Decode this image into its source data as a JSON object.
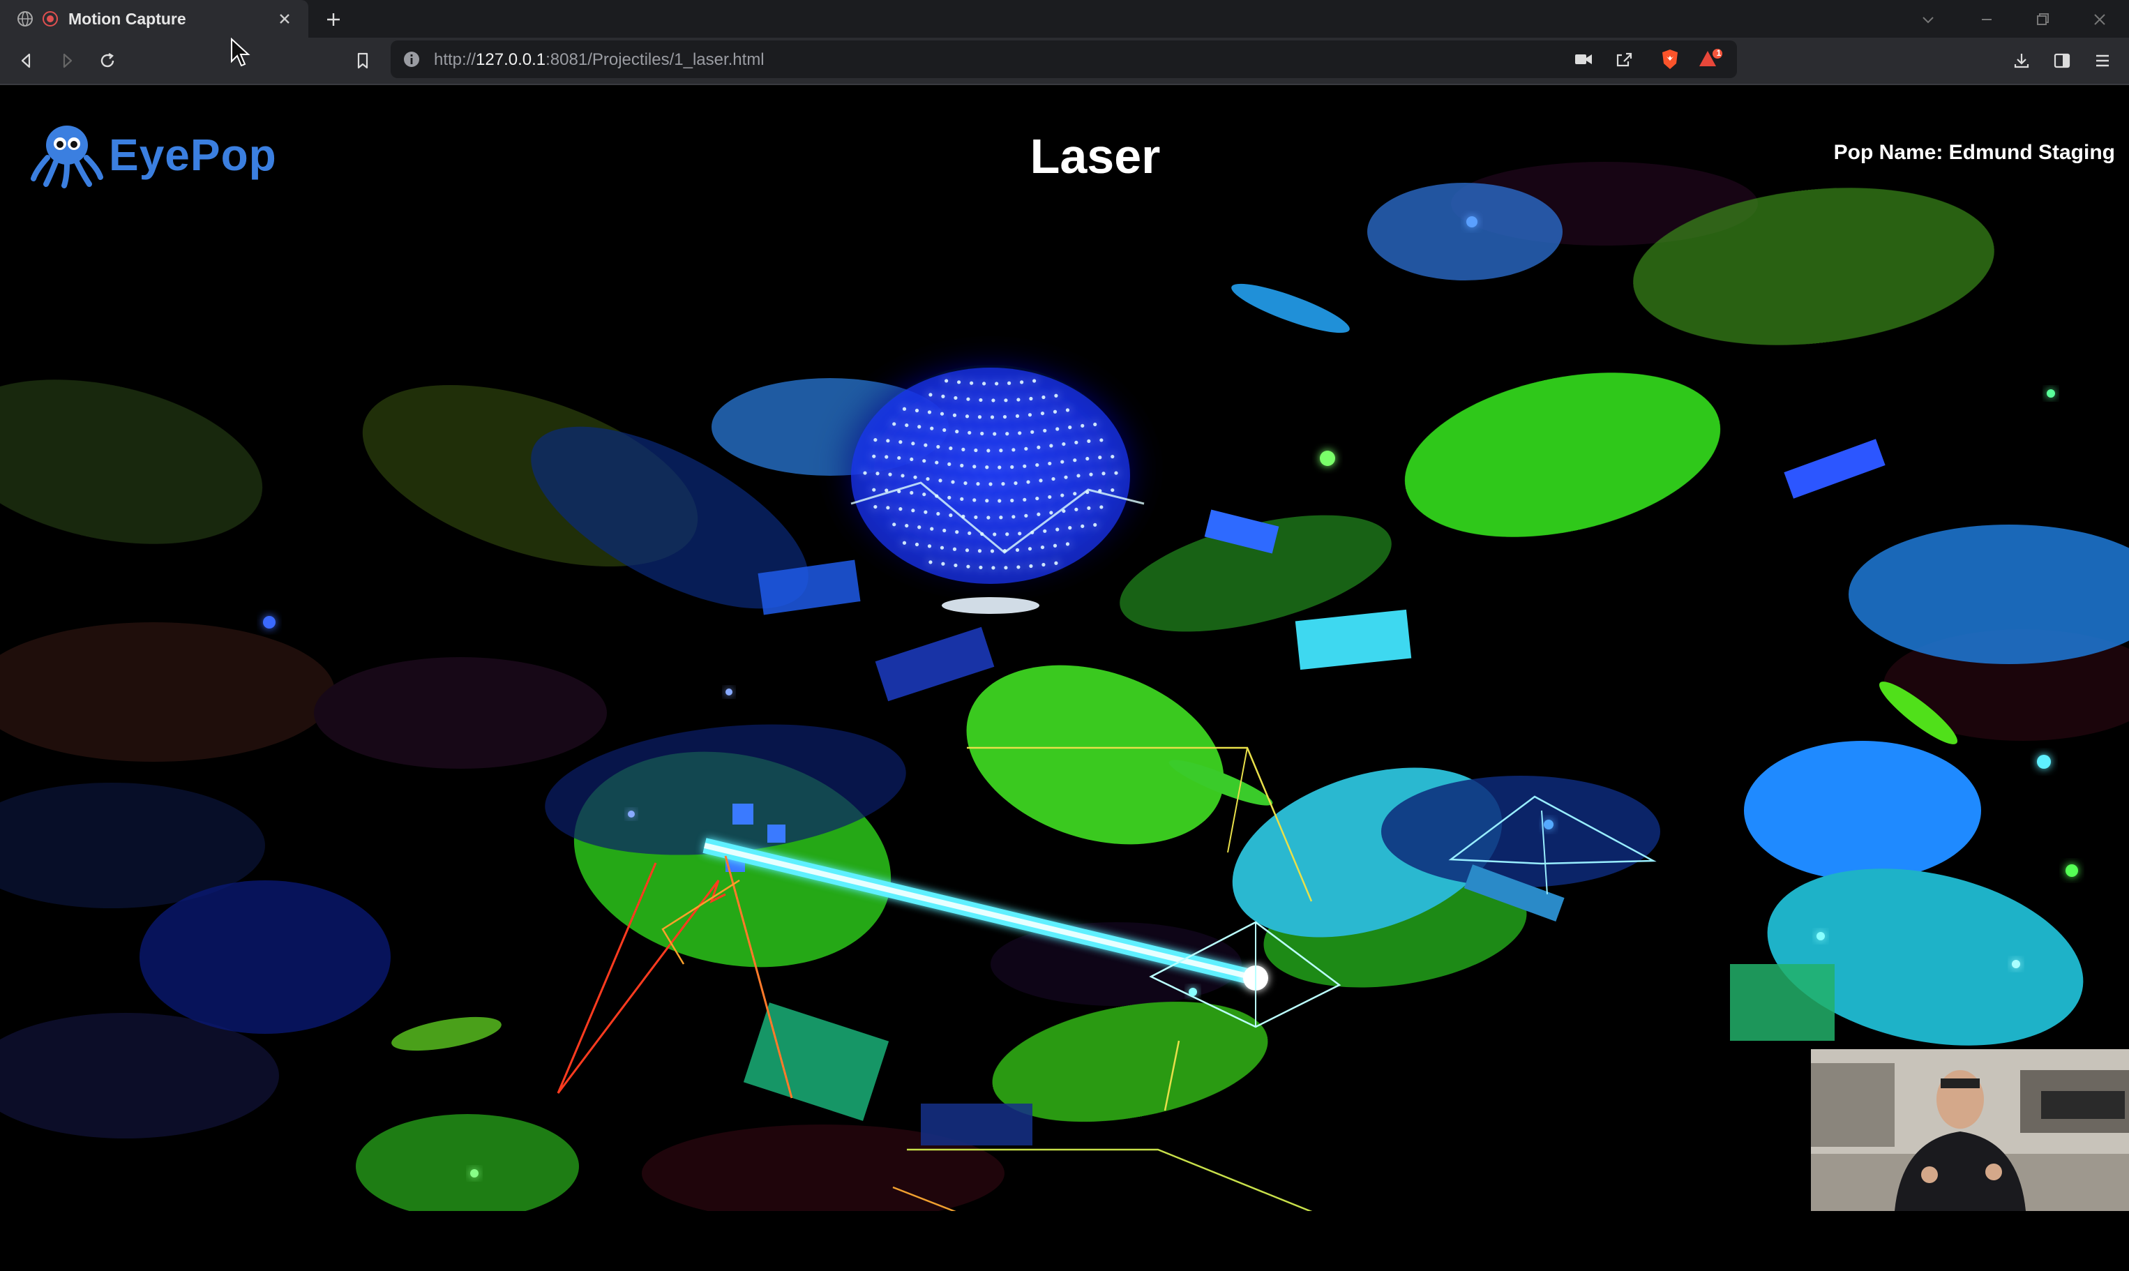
{
  "browser": {
    "tab": {
      "title": "Motion Capture"
    },
    "address": {
      "scheme": "http://",
      "host": "127.0.0.1",
      "path": ":8081/Projectiles/1_laser.html"
    },
    "notification_count": "1"
  },
  "page": {
    "logo_text": "EyePop",
    "title": "Laser",
    "pop_name": "Pop Name: Edmund Staging"
  },
  "colors": {
    "brand": "#3b7fe0",
    "chrome_bg": "#2b2c30",
    "laser_beam": "#5ff0ff",
    "laser_red": "#ff3b1f",
    "laser_yellow": "#e8e04a"
  },
  "icons": [
    "globe-icon",
    "record-icon",
    "close-icon",
    "plus-icon",
    "back-icon",
    "forward-icon",
    "reload-icon",
    "bookmark-icon",
    "info-icon",
    "camera-icon",
    "share-icon",
    "brave-shield-icon",
    "brave-rewards-icon",
    "download-icon",
    "sidebar-icon",
    "menu-icon",
    "cursor-icon"
  ]
}
